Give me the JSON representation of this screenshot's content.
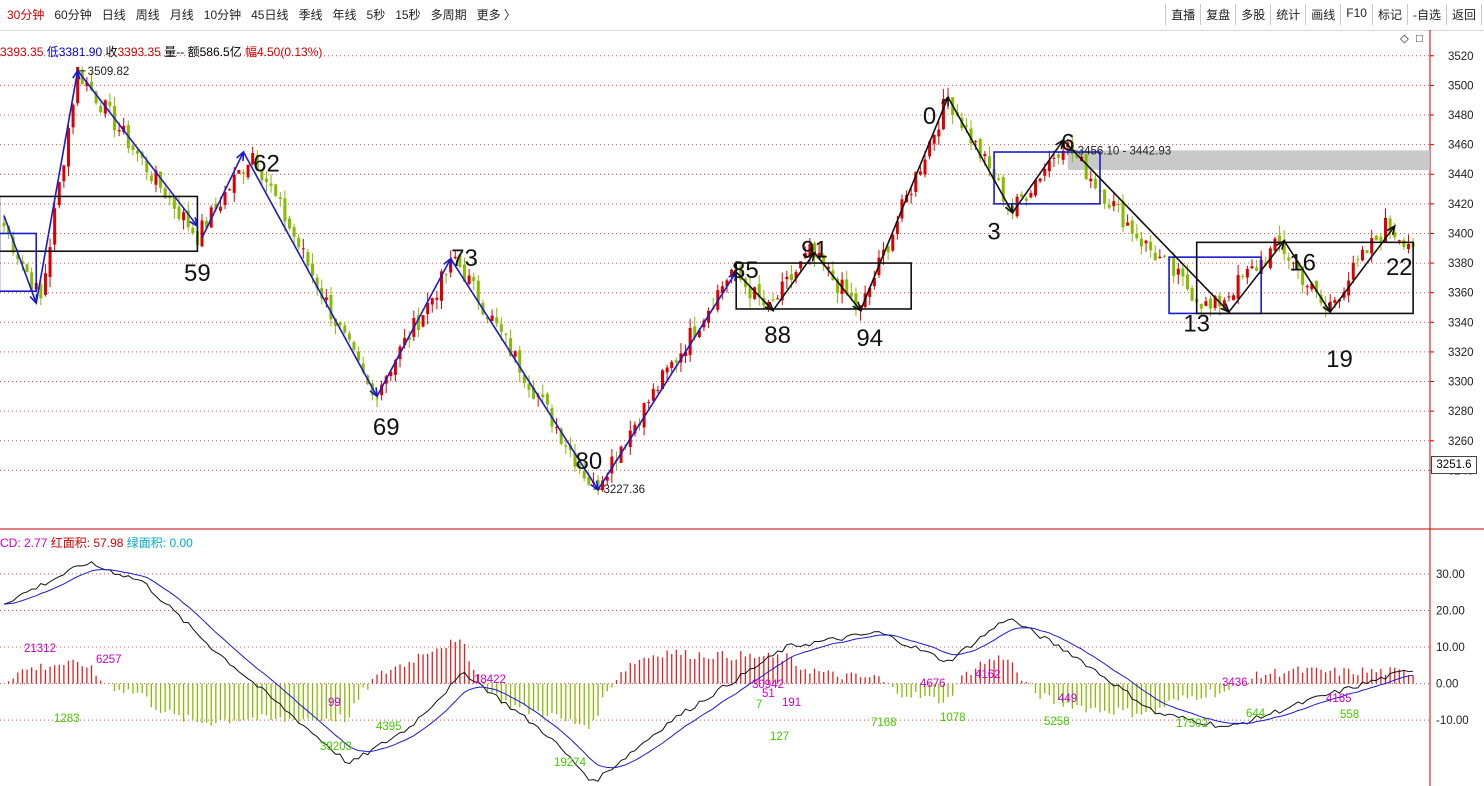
{
  "toolbar": {
    "periods": [
      "30分钟",
      "60分钟",
      "日线",
      "周线",
      "月线",
      "10分钟",
      "45日线",
      "季线",
      "年线",
      "5秒",
      "15秒",
      "多周期",
      "更多 〉"
    ],
    "active_period": "30分钟",
    "right_buttons": [
      "直播",
      "复盘",
      "多股",
      "统计",
      "画线",
      "F10",
      "标记",
      "-自选",
      "返回"
    ]
  },
  "info": {
    "open": "3393.35",
    "low_label": "低",
    "low": "3381.90",
    "close_label": "收",
    "close": "3393.35",
    "volume_label": "量--",
    "amount_label": "额",
    "amount": "586.5亿",
    "range_label": "幅",
    "range": "4.50(0.13%)"
  },
  "macd_info": {
    "macd_label": "CD:",
    "macd": "2.77",
    "red_label": "红面积:",
    "red": "57.98",
    "green_label": "绿面积:",
    "green": "0.00"
  },
  "colors": {
    "up": "#dd0000",
    "down": "#88bb00",
    "grid": "#dd2222",
    "wave_blue": "#1a1acc",
    "wave_black": "#111111",
    "macd_red": "#dd2222",
    "macd_green": "#88bb00",
    "label_mag": "#cc00cc",
    "label_green": "#44cc00"
  },
  "chart_data": [
    {
      "type": "candlestick",
      "title": "",
      "y_ticks": [
        3240,
        3260,
        3280,
        3300,
        3320,
        3340,
        3360,
        3380,
        3400,
        3420,
        3440,
        3460,
        3480,
        3500,
        3520
      ],
      "ylim": [
        3220,
        3532
      ],
      "last_price_badge": "3251.6",
      "close_path": [
        {
          "i": 0,
          "p": 3405
        },
        {
          "i": 8,
          "p": 3355
        },
        {
          "i": 16,
          "p": 3510
        },
        {
          "i": 32,
          "p": 3440
        },
        {
          "i": 42,
          "p": 3398
        },
        {
          "i": 54,
          "p": 3455
        },
        {
          "i": 80,
          "p": 3290
        },
        {
          "i": 98,
          "p": 3383
        },
        {
          "i": 128,
          "p": 3228
        },
        {
          "i": 158,
          "p": 3375
        },
        {
          "i": 166,
          "p": 3348
        },
        {
          "i": 175,
          "p": 3387
        },
        {
          "i": 186,
          "p": 3348
        },
        {
          "i": 205,
          "p": 3492
        },
        {
          "i": 219,
          "p": 3415
        },
        {
          "i": 230,
          "p": 3462
        },
        {
          "i": 247,
          "p": 3395
        },
        {
          "i": 262,
          "p": 3348
        },
        {
          "i": 277,
          "p": 3393
        },
        {
          "i": 287,
          "p": 3348
        },
        {
          "i": 300,
          "p": 3405
        },
        {
          "i": 306,
          "p": 3393
        }
      ],
      "price_annotations": [
        {
          "text": "3509.82",
          "i": 16,
          "p": 3509.82
        },
        {
          "text": "3227.36",
          "i": 128,
          "p": 3227.36
        },
        {
          "text": "3456.10 - 3442.93",
          "i": 231,
          "p": 3456.1
        }
      ],
      "resistance_band": [
        3442.93,
        3456.1
      ],
      "wave_labels": [
        {
          "text": "59",
          "i": 42,
          "p": 3374
        },
        {
          "text": "62",
          "i": 57,
          "p": 3448
        },
        {
          "text": "69",
          "i": 83,
          "p": 3270
        },
        {
          "text": "73",
          "i": 100,
          "p": 3384
        },
        {
          "text": "80",
          "i": 127,
          "p": 3247
        },
        {
          "text": "85",
          "i": 161,
          "p": 3376
        },
        {
          "text": "88",
          "i": 168,
          "p": 3332
        },
        {
          "text": "91",
          "i": 176,
          "p": 3390
        },
        {
          "text": "94",
          "i": 188,
          "p": 3330
        },
        {
          "text": "0",
          "i": 201,
          "p": 3480
        },
        {
          "text": "3",
          "i": 215,
          "p": 3402
        },
        {
          "text": "6",
          "i": 231,
          "p": 3462
        },
        {
          "text": "13",
          "i": 259,
          "p": 3340
        },
        {
          "text": "16",
          "i": 282,
          "p": 3381
        },
        {
          "text": "19",
          "i": 290,
          "p": 3316
        },
        {
          "text": "22",
          "i": 303,
          "p": 3378
        }
      ],
      "blue_waves": [
        [
          {
            "i": 0,
            "p": 3412
          },
          {
            "i": 7,
            "p": 3353
          },
          {
            "i": 16,
            "p": 3510
          },
          {
            "i": 42,
            "p": 3405
          }
        ],
        [
          {
            "i": 43,
            "p": 3397
          },
          {
            "i": 52,
            "p": 3455
          }
        ],
        [
          {
            "i": 52,
            "p": 3455
          },
          {
            "i": 81,
            "p": 3290
          },
          {
            "i": 97,
            "p": 3383
          },
          {
            "i": 129,
            "p": 3227
          },
          {
            "i": 159,
            "p": 3374
          }
        ]
      ],
      "black_waves": [
        [
          {
            "i": 159,
            "p": 3374
          },
          {
            "i": 167,
            "p": 3348
          },
          {
            "i": 176,
            "p": 3387
          },
          {
            "i": 186,
            "p": 3348
          },
          {
            "i": 205,
            "p": 3492
          },
          {
            "i": 219,
            "p": 3414
          },
          {
            "i": 230,
            "p": 3463
          },
          {
            "i": 266,
            "p": 3347
          },
          {
            "i": 278,
            "p": 3395
          },
          {
            "i": 288,
            "p": 3347
          },
          {
            "i": 302,
            "p": 3405
          }
        ]
      ],
      "boxes": [
        {
          "color": "black",
          "i0": -1,
          "i1": 42,
          "p0": 3388,
          "p1": 3425
        },
        {
          "color": "blue",
          "i0": -1,
          "i1": 7,
          "p0": 3361,
          "p1": 3400
        },
        {
          "color": "black",
          "i0": 159,
          "i1": 197,
          "p0": 3349,
          "p1": 3380
        },
        {
          "color": "blue",
          "i0": 215,
          "i1": 238,
          "p0": 3420,
          "p1": 3455
        },
        {
          "color": "blue",
          "i0": 253,
          "i1": 273,
          "p0": 3346,
          "p1": 3384
        },
        {
          "color": "black",
          "i0": 259,
          "i1": 306,
          "p0": 3346,
          "p1": 3394
        }
      ]
    },
    {
      "type": "macd",
      "y_ticks": [
        -10,
        0,
        10,
        20,
        30
      ],
      "y_tick_labels": [
        "-10.00",
        "0.00",
        "10.00",
        "20.00",
        "30.00"
      ],
      "ylim": [
        -28,
        42
      ],
      "labels_red": [
        "21312",
        "6257",
        "99",
        "18422",
        "30942",
        "51",
        "191",
        "4676",
        "4162",
        "449",
        "3436",
        "4165"
      ],
      "labels_green": [
        "1283",
        "39203",
        "4395",
        "19274",
        "7",
        "127",
        "7168",
        "1078",
        "5258",
        "17502",
        "644",
        "558"
      ]
    }
  ]
}
